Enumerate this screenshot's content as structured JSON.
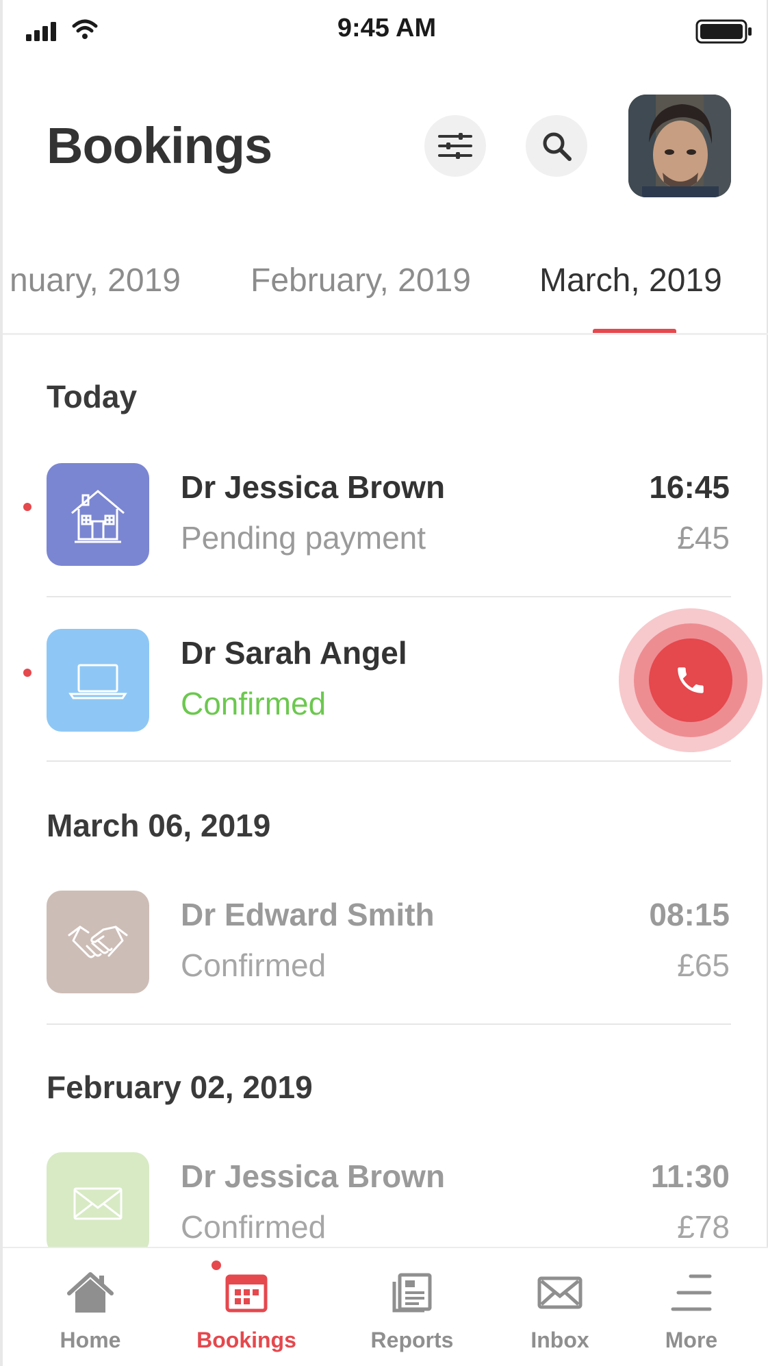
{
  "status_bar": {
    "time": "9:45 AM"
  },
  "header": {
    "title": "Bookings"
  },
  "tabs": [
    {
      "label": "nuary, 2019"
    },
    {
      "label": "February, 2019"
    },
    {
      "label": "March, 2019",
      "active": true
    }
  ],
  "sections": [
    {
      "title": "Today",
      "bookings": [
        {
          "name": "Dr Jessica Brown",
          "status": "Pending payment",
          "time": "16:45",
          "price": "£45",
          "icon": "house-icon",
          "icon_bg": "#7b86d2",
          "unread": true
        },
        {
          "name": "Dr Sarah Angel",
          "status": "Confirmed",
          "status_color": "#6cc84f",
          "icon": "laptop-icon",
          "icon_bg": "#8ec7f5",
          "unread": true,
          "action": "phone-call"
        }
      ]
    },
    {
      "title": "March 06, 2019",
      "bookings": [
        {
          "name": "Dr Edward Smith",
          "status": "Confirmed",
          "time": "08:15",
          "price": "£65",
          "icon": "handshake-icon",
          "icon_bg": "#cdbdb7"
        }
      ]
    },
    {
      "title": "February 02, 2019",
      "bookings": [
        {
          "name": "Dr Jessica Brown",
          "status": "Confirmed",
          "time": "11:30",
          "price": "£78",
          "icon": "envelope-icon",
          "icon_bg": "#d7eac4"
        }
      ]
    }
  ],
  "bottom_nav": [
    {
      "label": "Home",
      "icon": "home-icon"
    },
    {
      "label": "Bookings",
      "icon": "calendar-icon",
      "active": true,
      "badge": true
    },
    {
      "label": "Reports",
      "icon": "document-icon"
    },
    {
      "label": "Inbox",
      "icon": "inbox-icon"
    },
    {
      "label": "More",
      "icon": "menu-icon"
    }
  ],
  "colors": {
    "accent": "#e5484d",
    "confirmed": "#6cc84f"
  }
}
